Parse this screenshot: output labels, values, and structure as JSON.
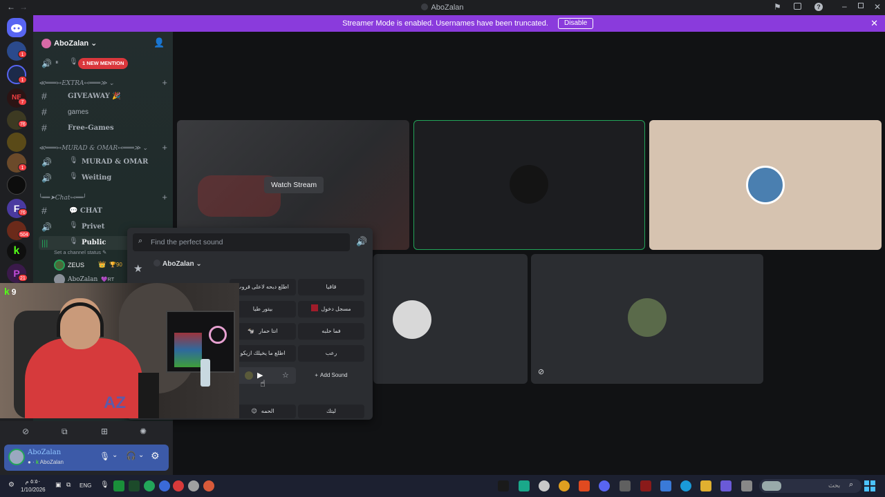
{
  "window": {
    "title": "AboZalan"
  },
  "banner": {
    "message": "Streamer Mode is enabled. Usernames have been truncated.",
    "disable_label": "Disable",
    "color": "#8a3bdc"
  },
  "guild_badges": [
    "1",
    "1",
    "7",
    "76",
    "1",
    "76",
    "504",
    "21"
  ],
  "server": {
    "name": "AboZalan"
  },
  "sidebar": {
    "mention_label": "1 NEW MENTION",
    "categories": {
      "extra": "≪═══↣EXTRA↢═══≫",
      "murad": "≪═══↣MURAD & OMAR↢═══≫",
      "chat": "╰══➤Chat↢══╯"
    },
    "channels": {
      "giveaway": "GIVEAWAY 🎉",
      "games": "games",
      "free_games": "Free-Games",
      "murad_omar": "MURAD & OMAR",
      "weiting": "Weiting",
      "chat": "💬 CHAT",
      "privet": "Privet",
      "public": "Public"
    },
    "channel_status": "Set a channel status",
    "voice_users": [
      {
        "name": "ZEUS",
        "extra": "90"
      },
      {
        "name": "AboZalan",
        "extra": "RT"
      }
    ]
  },
  "stream": {
    "watch_label": "Watch Stream"
  },
  "soundboard": {
    "placeholder": "Find the perfect sound",
    "server_name": "AboZalan",
    "sounds": [
      "اطلع دبحه لاعلى قروب",
      "قاقيا",
      "بيتور طيا",
      "مسجل دخول",
      "انتا حمار",
      "فما حلبه",
      "اطلع ما يخيلك ازيكو",
      "رعب",
      "الحمه",
      "ليتك"
    ],
    "add_sound_label": "Add Sound"
  },
  "webcam": {
    "overlay_text": "9"
  },
  "user_panel": {
    "username": "AboZalan",
    "status_text": "AboZalan"
  },
  "taskbar": {
    "time": "٥:٥٠ م",
    "date": "1/10/2026",
    "lang": "ENG",
    "search_placeholder": "بحث"
  },
  "colors": {
    "accent": "#5865f2",
    "speaking_green": "#23a55a",
    "mention_red": "#f23f43"
  }
}
